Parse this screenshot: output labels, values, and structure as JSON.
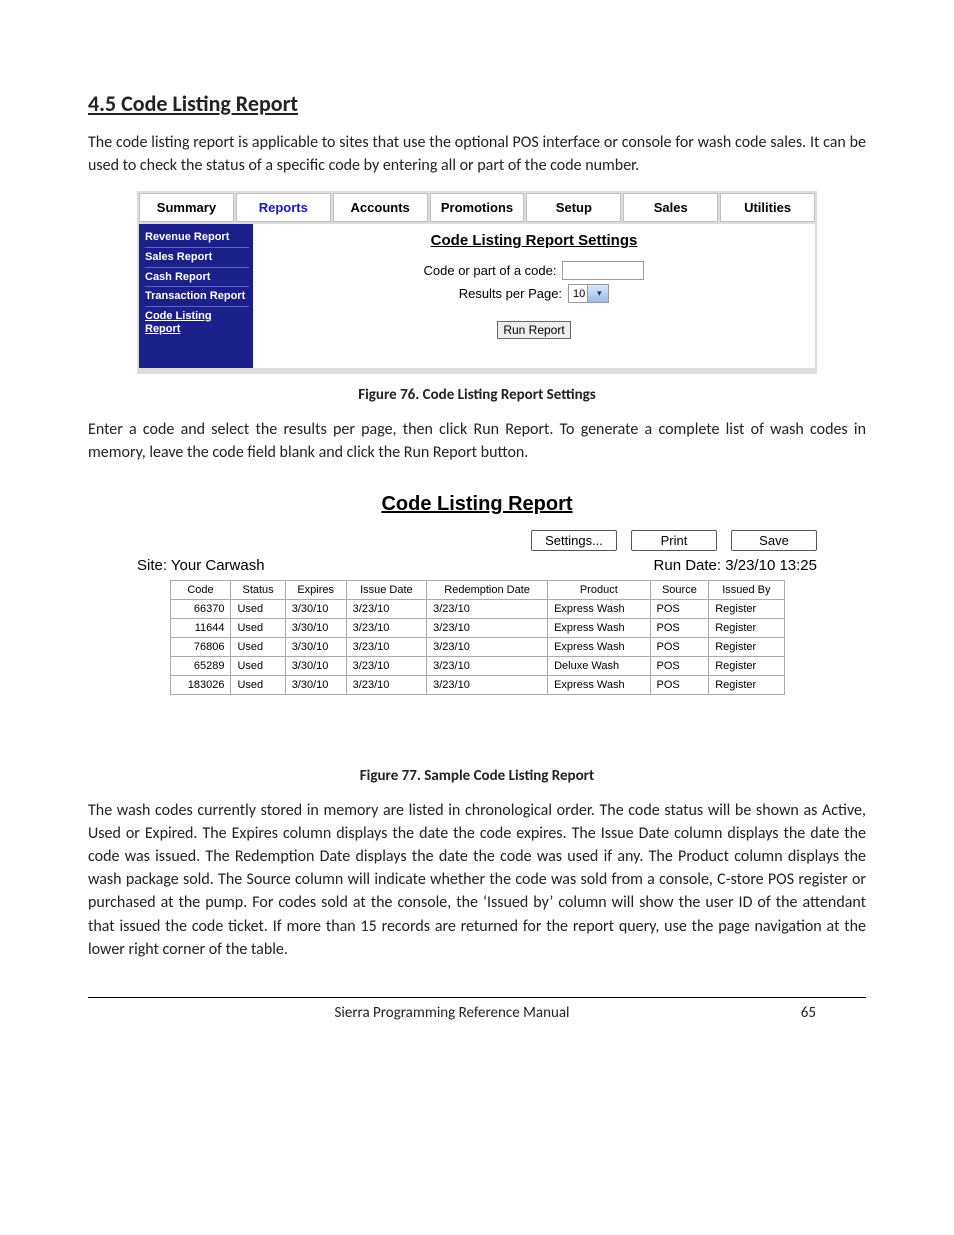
{
  "heading": "4.5   Code Listing Report",
  "para1": "The code listing report is applicable to sites that use the optional POS interface or console for wash code sales. It can be used to check the status of a specific code by entering all or part of the code number.",
  "fig1": {
    "tabs": [
      "Summary",
      "Reports",
      "Accounts",
      "Promotions",
      "Setup",
      "Sales",
      "Utilities"
    ],
    "activeTab": "Reports",
    "sideItems": [
      "Revenue Report",
      "Sales Report",
      "Cash Report",
      "Transaction Report",
      "Code Listing Report"
    ],
    "selectedSide": "Code Listing Report",
    "panelTitle": "Code Listing Report Settings",
    "labelCode": "Code or part of a code:",
    "labelRpp": "Results per Page:",
    "rppValue": "10",
    "runBtn": "Run Report"
  },
  "caption1": "Figure 76. Code Listing Report Settings",
  "para2": "Enter a code and select the results per page, then click Run Report. To generate a complete list of wash codes in memory, leave the code field blank and click the Run Report button.",
  "fig2": {
    "title": "Code Listing Report",
    "buttons": [
      "Settings...",
      "Print",
      "Save"
    ],
    "siteLabel": "Site: Your Carwash",
    "runDate": "Run Date: 3/23/10 13:25",
    "columns": [
      "Code",
      "Status",
      "Expires",
      "Issue Date",
      "Redemption Date",
      "Product",
      "Source",
      "Issued By"
    ],
    "rows": [
      [
        "66370",
        "Used",
        "3/30/10",
        "3/23/10",
        "3/23/10",
        "Express Wash",
        "POS",
        "Register"
      ],
      [
        "11644",
        "Used",
        "3/30/10",
        "3/23/10",
        "3/23/10",
        "Express Wash",
        "POS",
        "Register"
      ],
      [
        "76806",
        "Used",
        "3/30/10",
        "3/23/10",
        "3/23/10",
        "Express Wash",
        "POS",
        "Register"
      ],
      [
        "65289",
        "Used",
        "3/30/10",
        "3/23/10",
        "3/23/10",
        "Deluxe Wash",
        "POS",
        "Register"
      ],
      [
        "183026",
        "Used",
        "3/30/10",
        "3/23/10",
        "3/23/10",
        "Express Wash",
        "POS",
        "Register"
      ]
    ]
  },
  "caption2": "Figure 77. Sample Code Listing Report",
  "para3": "The wash codes currently stored in memory are listed in chronological order. The code status will be shown as Active, Used or Expired. The Expires column displays the date the code expires. The Issue Date column displays the date the code was issued. The Redemption Date displays the date the code was used if any. The Product column displays the wash package sold. The Source column will indicate whether the code was sold from a console, C-store POS register or purchased at the pump. For codes sold at the console, the ‘Issued by’ column will show the user ID of the attendant that issued the code ticket. If more than 15 records are returned for the report query, use the page navigation at the lower right corner of the table.",
  "footerTitle": "Sierra Programming Reference Manual",
  "pageNumber": "65"
}
